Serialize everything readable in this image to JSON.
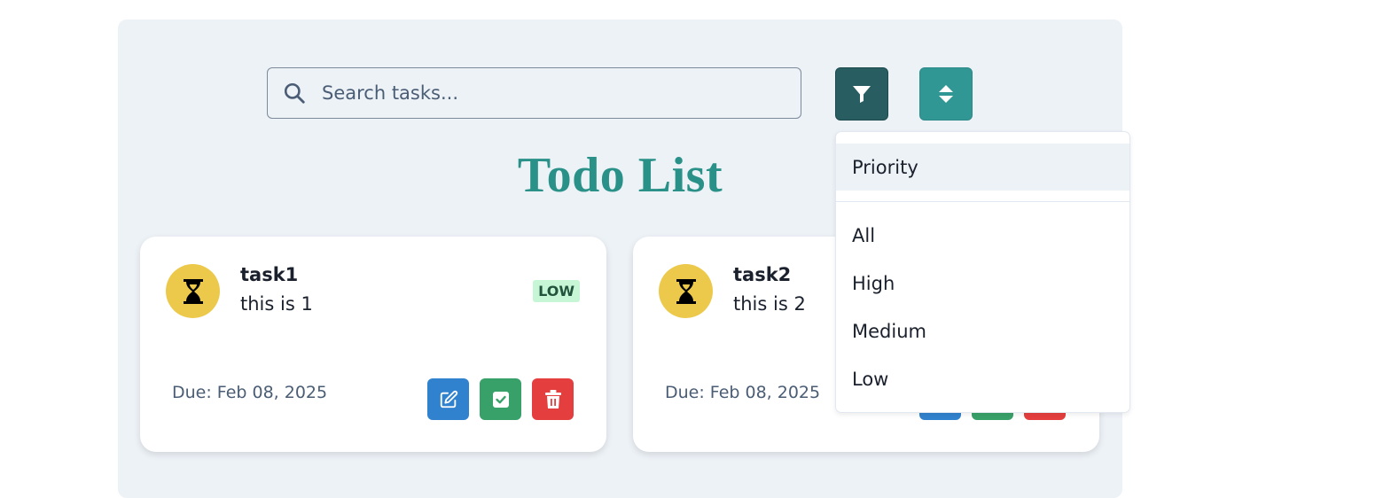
{
  "search": {
    "placeholder": "Search tasks...",
    "icon": "search-icon"
  },
  "toolbar": {
    "filter_icon": "filter-icon",
    "sort_icon": "sort-icon"
  },
  "title": "Todo List",
  "tasks": [
    {
      "title": "task1",
      "description": "this is 1",
      "priority": "LOW",
      "due": "Due: Feb 08, 2025",
      "status_icon": "hourglass-icon"
    },
    {
      "title": "task2",
      "description": "this is 2",
      "due": "Due: Feb 08, 2025",
      "status_icon": "hourglass-icon"
    }
  ],
  "filter_menu": {
    "group_label": "Priority",
    "options": [
      "All",
      "High",
      "Medium",
      "Low"
    ]
  },
  "colors": {
    "filter_button": "#285e61",
    "sort_button": "#319795",
    "title": "#2a9188",
    "avatar": "#ecc94b",
    "edit": "#3182ce",
    "complete": "#38a169",
    "delete": "#e53e3e",
    "badge_low": "#c6f6d5"
  }
}
